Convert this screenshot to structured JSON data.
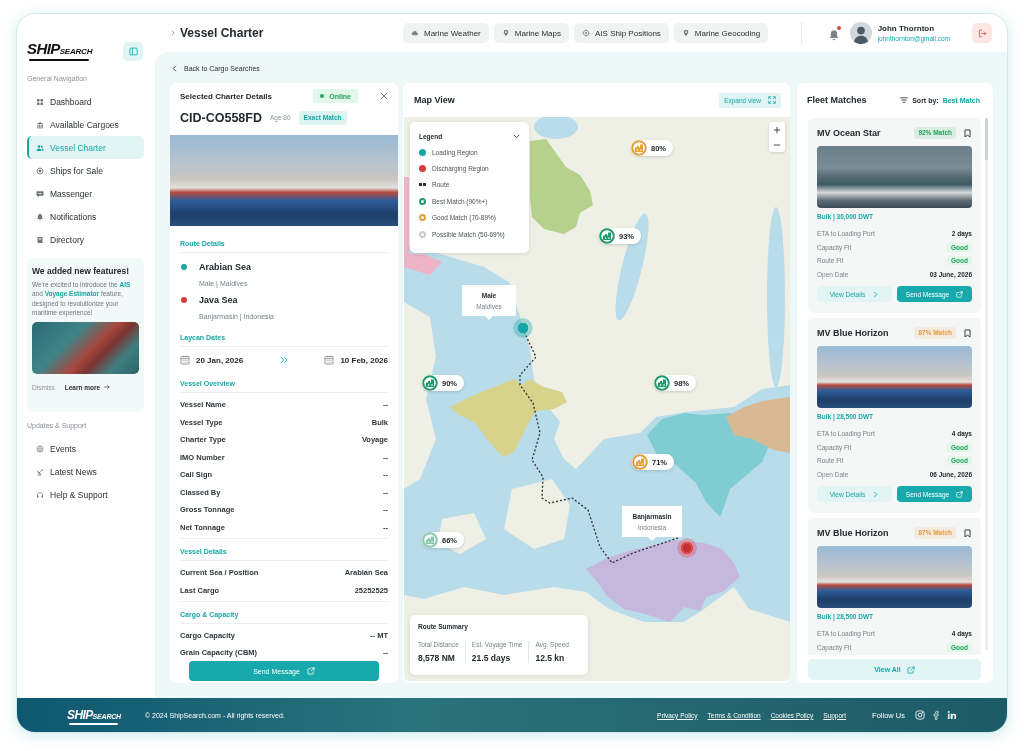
{
  "sidebar": {
    "logo": {
      "primary": "SHIP",
      "secondary": "SEARCH"
    },
    "general": {
      "title": "General Navigation",
      "items": [
        {
          "label": "Dashboard",
          "selected": false
        },
        {
          "label": "Available Cargoes",
          "selected": false
        },
        {
          "label": "Vessel Charter",
          "selected": true
        },
        {
          "label": "Ships for Sale",
          "selected": false
        },
        {
          "label": "Massenger",
          "selected": false
        },
        {
          "label": "Notifications",
          "selected": false
        },
        {
          "label": "Directory",
          "selected": false
        }
      ]
    },
    "promo": {
      "title": "We added new features!",
      "text": "We're excited to introduce the **AIS** and **Voyage Estimator** feature, designed to revolutionize your maritime experience!",
      "dismiss": "Dismiss",
      "learn_more": "Learn more"
    },
    "support": {
      "title": "Updates & Support",
      "items": [
        {
          "label": "Events",
          "selected": false
        },
        {
          "label": "Latest News",
          "selected": false
        },
        {
          "label": "Help & Support",
          "selected": false
        }
      ]
    }
  },
  "header": {
    "title": "Vessel Charter",
    "tabs": [
      {
        "label": "Marine Weather"
      },
      {
        "label": "Marine Maps"
      },
      {
        "label": "AIS Ship Positions"
      },
      {
        "label": "Marine Geocoding"
      }
    ],
    "user": {
      "name": "John Thornton",
      "email": "johnthornton@gmail.com",
      "unread": true
    }
  },
  "back_link": "Back to Cargo Searches",
  "charter": {
    "heading": "Selected Charter Details",
    "status": "Online",
    "id": "CID-CO558FD",
    "age": "Age 80",
    "match": "Exact Match",
    "route_title": "Route Details",
    "route": [
      {
        "name": "Arabian Sea",
        "place": "Male | Maldives",
        "color": "#17a6a6"
      },
      {
        "name": "Java Sea",
        "place": "Banjarmasin | Indonesia",
        "color": "#d63c3c"
      }
    ],
    "laycan": {
      "title": "Laycan Dates",
      "from": "20 Jan, 2026",
      "to": "10 Feb, 2026"
    },
    "sections": [
      {
        "title": "Vessel Overview",
        "rows": [
          {
            "label": "Vessel Name",
            "value": "--"
          },
          {
            "label": "Vessel Type",
            "value": "Bulk"
          },
          {
            "label": "Charter Type",
            "value": "Voyage"
          },
          {
            "label": "IMO Number",
            "value": "--"
          },
          {
            "label": "Call Sign",
            "value": "--"
          },
          {
            "label": "Classed By",
            "value": "--"
          },
          {
            "label": "Gross Tonnage",
            "value": "--"
          },
          {
            "label": "Net Tonnage",
            "value": "--"
          }
        ]
      },
      {
        "title": "Vessel Details",
        "rows": [
          {
            "label": "Current Sea / Position",
            "value": "Arabian Sea"
          },
          {
            "label": "Last Cargo",
            "value": "25252525"
          }
        ]
      },
      {
        "title": "Cargo & Capacity",
        "rows": [
          {
            "label": "Cargo Capacity",
            "value": "-- MT"
          },
          {
            "label": "Grain Capacity (CBM)",
            "value": "--"
          }
        ]
      }
    ],
    "button": "Send Message"
  },
  "map": {
    "title": "Map View",
    "expand": "Expand view",
    "legend": {
      "title": "Legend",
      "expanded": true,
      "items": [
        {
          "kind": "dot",
          "label": "Loading Region",
          "color": "#17a6a6"
        },
        {
          "kind": "dot",
          "label": "Discharging Region",
          "color": "#d63c3c"
        },
        {
          "kind": "dash",
          "label": "Route",
          "color": "#2a2f33"
        },
        {
          "kind": "ring",
          "label": "Best Match (90%+)",
          "color": "#1f9b6e"
        },
        {
          "kind": "ring",
          "label": "Good Match (70-89%)",
          "color": "#e3a03a"
        },
        {
          "kind": "ring",
          "label": "Possible Match (50-69%)",
          "color": "#c8cccf"
        }
      ]
    },
    "markers": [
      {
        "label": "80%",
        "color": "#e3a03a"
      },
      {
        "label": "93%",
        "color": "#1f9b6e"
      },
      {
        "label": "90%",
        "color": "#1f9b6e"
      },
      {
        "label": "98%",
        "color": "#1f9b6e"
      },
      {
        "label": "71%",
        "color": "#e3a03a"
      },
      {
        "label": "66%",
        "color": "#86c7a8"
      }
    ],
    "popups": [
      {
        "place": "Male",
        "country": "Maldives"
      },
      {
        "place": "Banjarmasin",
        "country": "Indonesia"
      }
    ],
    "summary": {
      "title": "Route Summary",
      "stats": [
        {
          "label": "Total Distance",
          "value": "8,578 NM"
        },
        {
          "label": "Est. Voyage Time",
          "value": "21.5 days"
        },
        {
          "label": "Avg. Speed",
          "value": "12.5 kn"
        }
      ]
    }
  },
  "fleet": {
    "title": "Fleet Matches",
    "sort_label": "Sort by:",
    "sort_value": "Best Match",
    "cards": [
      {
        "name": "MV Ocean Star",
        "match": "92% Match",
        "color": "#22a45a",
        "spec": "Bulk | 30,000 DWT",
        "rows": [
          {
            "label": "ETA to Loading Port",
            "value": "2 days",
            "kind": "text"
          },
          {
            "label": "Capacity Fit",
            "value": "Good",
            "kind": "badge"
          },
          {
            "label": "Route Fit",
            "value": "Good",
            "kind": "badge"
          },
          {
            "label": "Open Date",
            "value": "03 June, 2026",
            "kind": "text"
          }
        ],
        "actions": [
          "View Details",
          "Send Message"
        ]
      },
      {
        "name": "MV Blue Horizon",
        "match": "87% Match",
        "color": "#e89a3c",
        "spec": "Bulk | 28,500 DWT",
        "rows": [
          {
            "label": "ETA to Loading Port",
            "value": "4 days",
            "kind": "text"
          },
          {
            "label": "Capacity Fit",
            "value": "Good",
            "kind": "badge"
          },
          {
            "label": "Route Fit",
            "value": "Good",
            "kind": "badge"
          },
          {
            "label": "Open Date",
            "value": "06 June, 2026",
            "kind": "text"
          }
        ],
        "actions": [
          "View Details",
          "Send Message"
        ]
      },
      {
        "name": "MV Blue Horizon",
        "match": "87% Match",
        "color": "#e89a3c",
        "spec": "Bulk | 28,500 DWT",
        "rows": [
          {
            "label": "ETA to Loading Port",
            "value": "4 days",
            "kind": "text"
          },
          {
            "label": "Capacity Fit",
            "value": "Good",
            "kind": "badge"
          }
        ]
      }
    ],
    "view_all": "View All"
  },
  "footer": {
    "logo": {
      "primary": "SHIP",
      "secondary": "SEARCH"
    },
    "copyright": "© 2024 ShipSearch.com - All rights reserved.",
    "links": [
      "Privacy Policy",
      "Terms & Condition",
      "Cookies Policy",
      "Support"
    ],
    "follow": "Follow Us"
  }
}
